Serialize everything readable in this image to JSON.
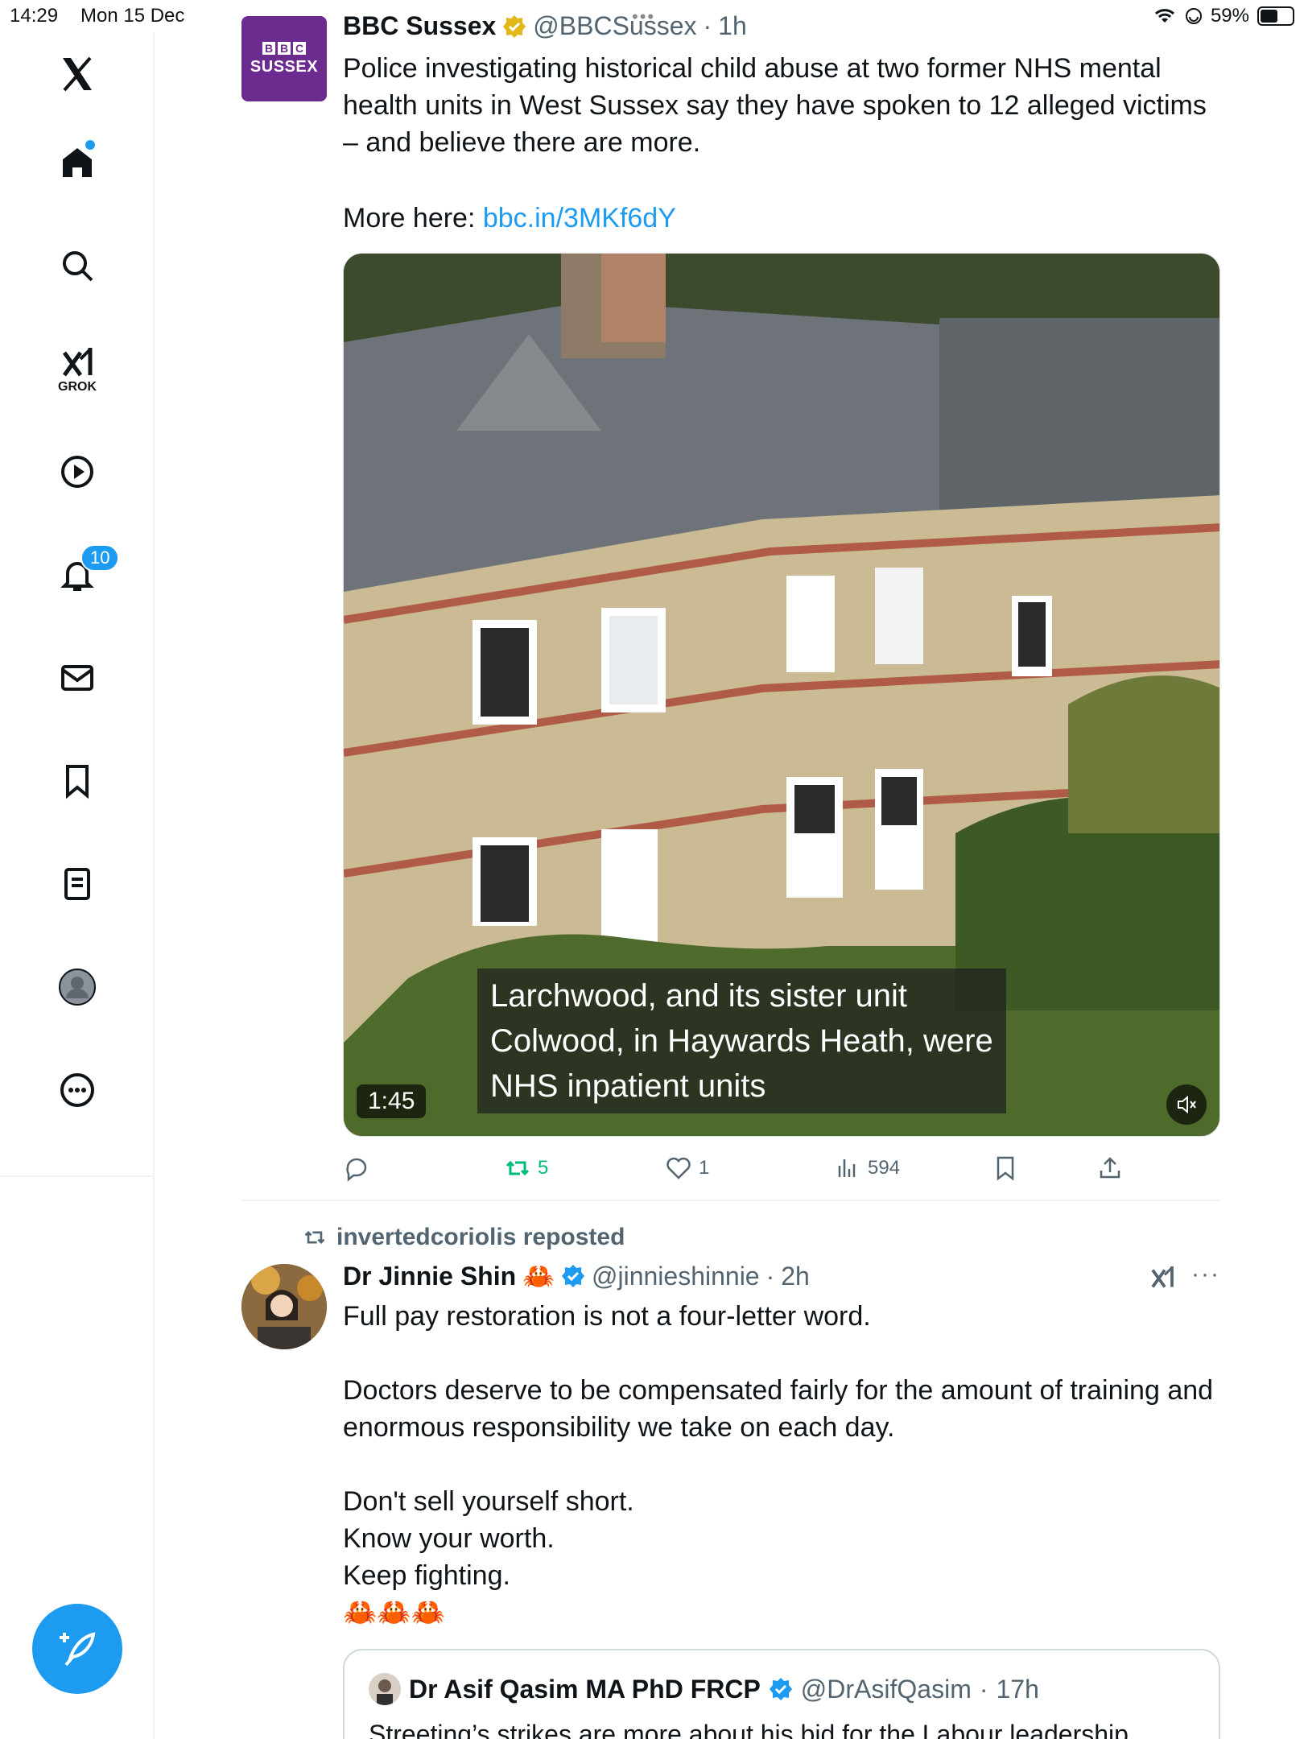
{
  "status_bar": {
    "time": "14:29",
    "date": "Mon 15 Dec",
    "battery": "59%",
    "battery_level": 0.59
  },
  "sidebar": {
    "notifications_count": "10",
    "grok_label": "GROK",
    "items": [
      "x-logo",
      "home",
      "search",
      "grok",
      "video",
      "notifications",
      "messages",
      "bookmarks",
      "lists",
      "profile",
      "more"
    ]
  },
  "tweet1": {
    "name": "BBC Sussex",
    "handle": "@BBCSussex",
    "time": "1h",
    "avatar_text_top": [
      "B",
      "B",
      "C"
    ],
    "avatar_text_bottom": "SUSSEX",
    "text": "Police investigating historical child abuse at two former NHS mental health units in West Sussex say they have spoken to 12 alleged victims – and believe there are more.",
    "more_label": "More here: ",
    "link": "bbc.in/3MKf6dY",
    "video": {
      "caption": "Larchwood, and its sister unit\nColwood, in Haywards Heath, were\nNHS inpatient units",
      "duration": "1:45"
    },
    "actions": {
      "replies": "",
      "retweets": "5",
      "likes": "1",
      "views": "594"
    }
  },
  "tweet2": {
    "reposted_by": "invertedcoriolis reposted",
    "name": "Dr Jinnie Shin",
    "name_emoji": "🦀",
    "handle": "@jinnieshinnie",
    "time": "2h",
    "text": "Full pay restoration is not a four-letter word.\n\nDoctors deserve to be compensated fairly for the amount of training and enormous responsibility we take on each day.\n\nDon't sell yourself short.\nKnow your worth.\nKeep fighting.\n🦀🦀🦀",
    "quote": {
      "name": "Dr Asif Qasim MA PhD FRCP",
      "handle": "@DrAsifQasim",
      "time": "17h",
      "text": "Streeting’s strikes are more about his bid for the Labour leadership"
    }
  },
  "colors": {
    "accent": "#1d9bf0",
    "retweet_green": "#00ba7c",
    "bbc_purple": "#6c2b8f",
    "verified_gold": "#e2b719",
    "muted_text": "#536471"
  }
}
